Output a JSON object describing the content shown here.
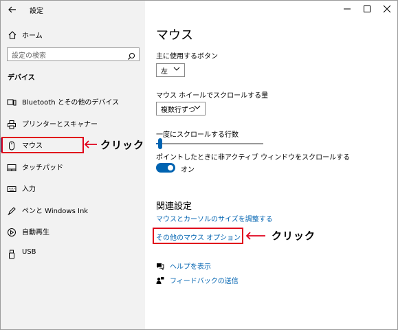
{
  "titlebar": {
    "title": "設定"
  },
  "sidebar": {
    "home_label": "ホーム",
    "search_placeholder": "設定の検索",
    "section_title": "デバイス",
    "items": [
      {
        "label": "Bluetooth とその他のデバイス",
        "icon": "devices-icon"
      },
      {
        "label": "プリンターとスキャナー",
        "icon": "printer-icon"
      },
      {
        "label": "マウス",
        "icon": "mouse-icon"
      },
      {
        "label": "タッチパッド",
        "icon": "touchpad-icon"
      },
      {
        "label": "入力",
        "icon": "keyboard-icon"
      },
      {
        "label": "ペンと Windows Ink",
        "icon": "pen-icon"
      },
      {
        "label": "自動再生",
        "icon": "autoplay-icon"
      },
      {
        "label": "USB",
        "icon": "usb-icon"
      }
    ],
    "selected_index": 2
  },
  "main": {
    "title": "マウス",
    "primary_button": {
      "label": "主に使用するボタン",
      "value": "左"
    },
    "wheel_scroll": {
      "label": "マウス ホイールでスクロールする量",
      "value": "複数行ずつ"
    },
    "lines_to_scroll": {
      "label": "一度にスクロールする行数",
      "value_fraction": 0.02
    },
    "inactive_scroll": {
      "label": "ポイントしたときに非アクティブ ウィンドウをスクロールする",
      "toggle_label": "オン",
      "on": true
    },
    "related": {
      "title": "関連設定",
      "link1": "マウスとカーソルのサイズを調整する",
      "link2": "その他のマウス オプション"
    },
    "help_label": "ヘルプを表示",
    "feedback_label": "フィードバックの送信"
  },
  "annotations": {
    "click1": "クリック",
    "click2": "クリック"
  },
  "colors": {
    "accent": "#0063b1",
    "highlight": "#e0001b",
    "sidebar_bg": "#f2f2f2"
  }
}
